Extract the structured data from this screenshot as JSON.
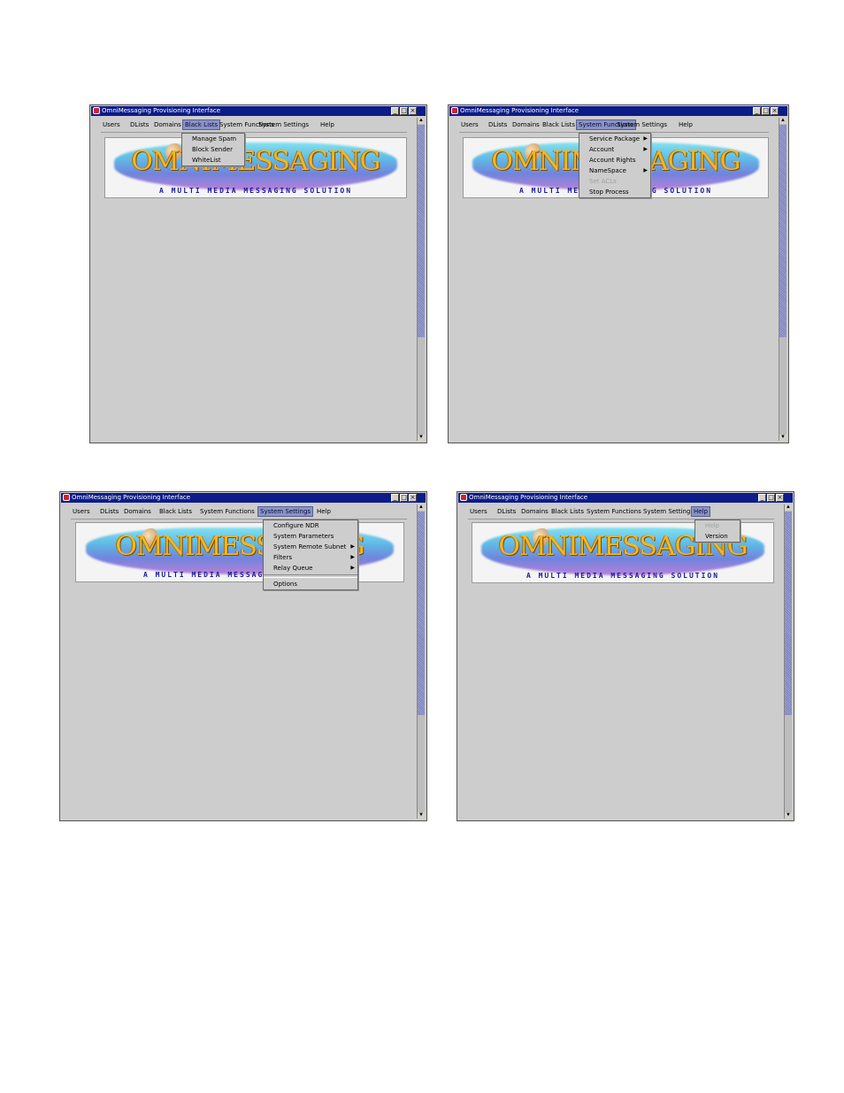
{
  "window_title": "OmniMessaging Provisioning Interface",
  "title_buttons": {
    "minimize": "_",
    "maximize": "□",
    "close": "×"
  },
  "menus": [
    "Users",
    "DLists",
    "Domains",
    "Black Lists",
    "System Functions",
    "System Settings",
    "Help"
  ],
  "banner": {
    "logo_text": "OMNIMESSAGING",
    "tagline": "A MULTI MEDIA MESSAGING SOLUTION"
  },
  "scroll": {
    "up": "▲",
    "down": "▼"
  },
  "panels": [
    {
      "active_menu": "Black Lists",
      "items": [
        {
          "label": "Manage Spam",
          "submenu": false,
          "disabled": false
        },
        {
          "label": "Block Sender",
          "submenu": false,
          "disabled": false
        },
        {
          "label": "WhiteList",
          "submenu": false,
          "disabled": false
        }
      ]
    },
    {
      "active_menu": "System Functions",
      "items": [
        {
          "label": "Service Package",
          "submenu": true,
          "disabled": false
        },
        {
          "label": "Account",
          "submenu": true,
          "disabled": false
        },
        {
          "label": "Account Rights",
          "submenu": false,
          "disabled": false
        },
        {
          "label": "NameSpace",
          "submenu": true,
          "disabled": false
        },
        {
          "label": "Set ACLs",
          "submenu": false,
          "disabled": true
        },
        {
          "label": "Stop Process",
          "submenu": false,
          "disabled": false
        }
      ]
    },
    {
      "active_menu": "System Settings",
      "items": [
        {
          "label": "Configure NDR",
          "submenu": false,
          "disabled": false
        },
        {
          "label": "System Parameters",
          "submenu": false,
          "disabled": false
        },
        {
          "label": "System Remote Subnet",
          "submenu": true,
          "disabled": false
        },
        {
          "label": "Filters",
          "submenu": true,
          "disabled": false
        },
        {
          "label": "Relay Queue",
          "submenu": true,
          "disabled": false
        },
        {
          "separator": true
        },
        {
          "label": "Options",
          "submenu": false,
          "disabled": false
        }
      ]
    },
    {
      "active_menu": "Help",
      "items": [
        {
          "label": "Help",
          "submenu": false,
          "disabled": true
        },
        {
          "label": "Version",
          "submenu": false,
          "disabled": false
        }
      ]
    }
  ]
}
